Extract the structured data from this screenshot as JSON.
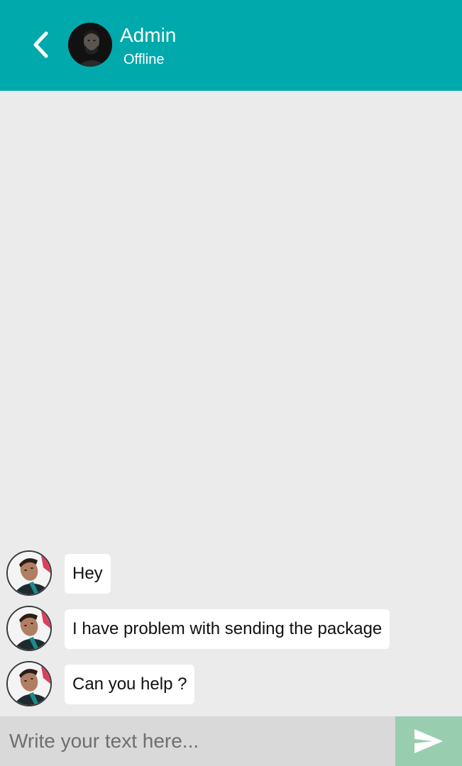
{
  "header": {
    "contact_name": "Admin",
    "contact_status": "Offline",
    "back_icon": "chevron-left-icon",
    "background_color": "#00a9ab"
  },
  "messages": [
    {
      "text": "Hey"
    },
    {
      "text": "I have problem with sending the package"
    },
    {
      "text": "Can you help ?"
    }
  ],
  "composer": {
    "placeholder": "Write your text here...",
    "send_icon": "send-icon",
    "send_button_color": "#98cdb0"
  },
  "colors": {
    "chat_background": "#ebebeb",
    "bubble_background": "#ffffff"
  }
}
